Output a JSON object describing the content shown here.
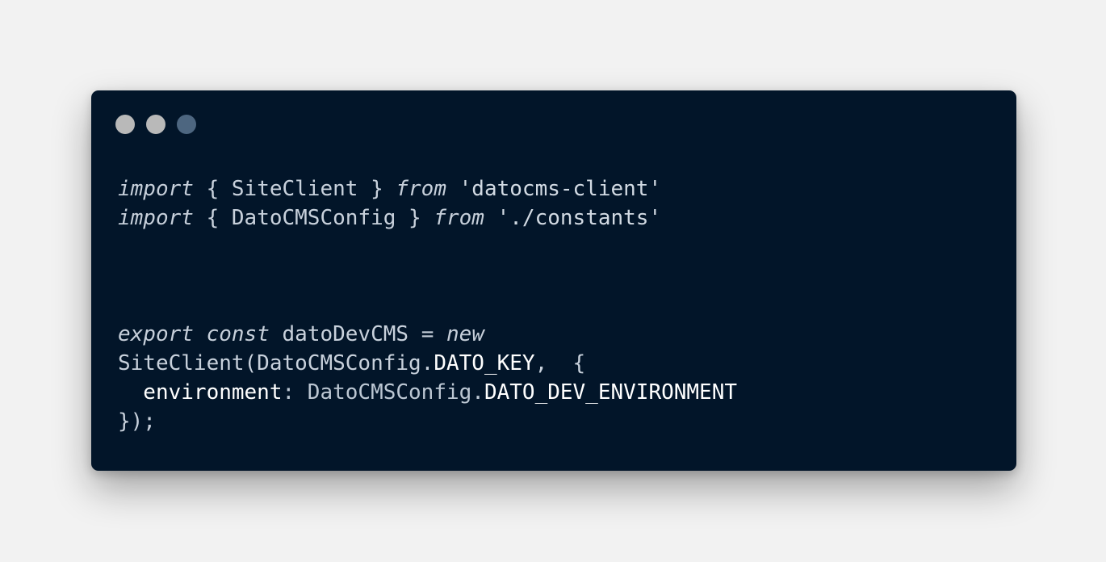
{
  "window": {
    "dots": [
      {
        "name": "close-dot",
        "color": "#b9b9b9"
      },
      {
        "name": "minimize-dot",
        "color": "#b9b9b9"
      },
      {
        "name": "zoom-dot",
        "color": "#4d6680"
      }
    ]
  },
  "code": {
    "line1": {
      "kw_import": "import",
      "part1": " { SiteClient } ",
      "kw_from": "from",
      "part2": " 'datocms-client'"
    },
    "line2": {
      "kw_import": "import",
      "part1": " { DatoCMSConfig } ",
      "kw_from": "from",
      "part2": " './constants'"
    },
    "line3": {
      "kw_export": "export",
      "space1": " ",
      "kw_const": "const",
      "part1": " datoDevCMS = ",
      "kw_new": "new"
    },
    "line4": {
      "part1": "SiteClient(DatoCMSConfig.",
      "part2": "DATO_KEY",
      "part3": ",  {"
    },
    "line5": {
      "part1": "  environment",
      "part2": ": DatoCMSConfig.",
      "part3": "DATO_DEV_ENVIRONMENT"
    },
    "line6": {
      "part1": "});"
    }
  }
}
